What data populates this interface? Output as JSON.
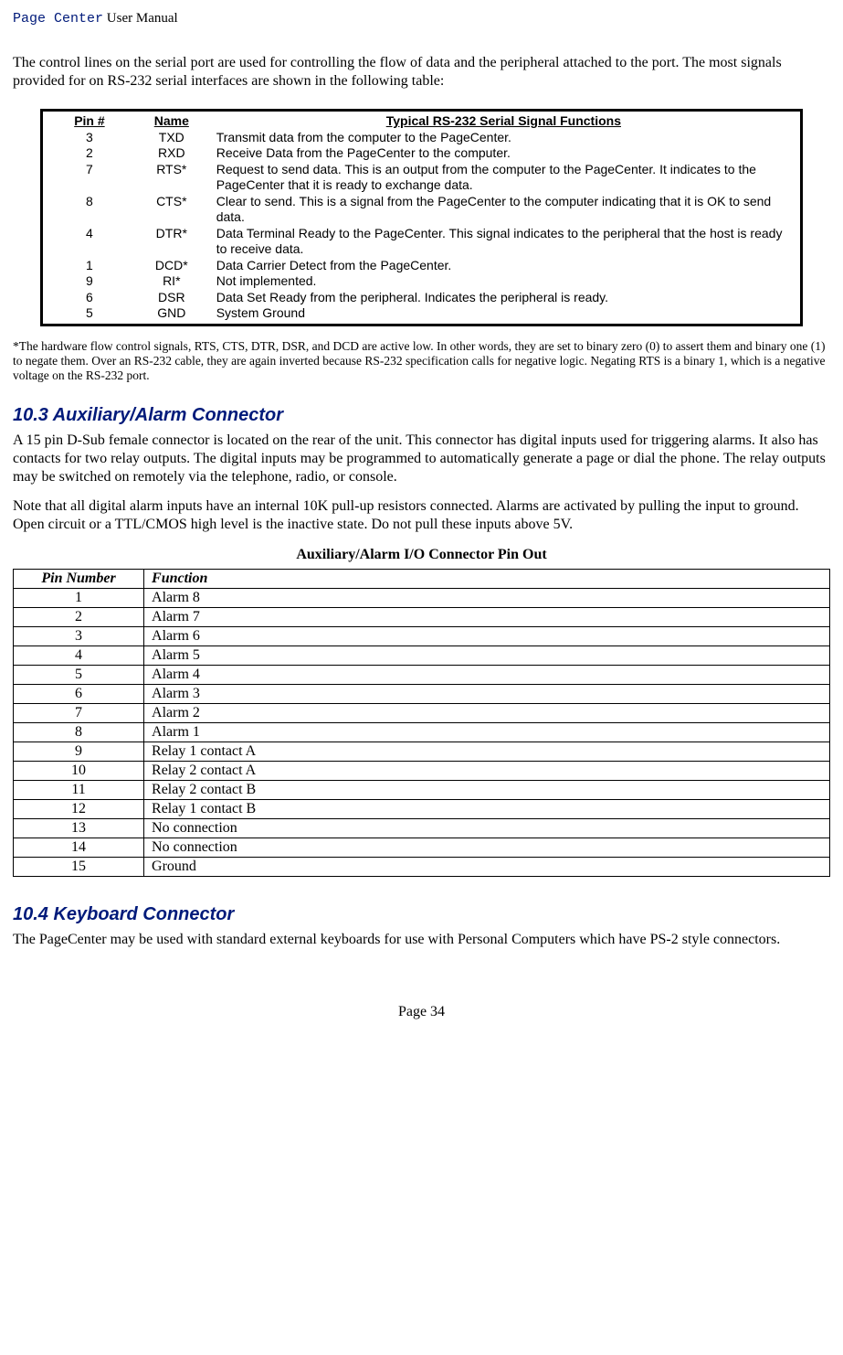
{
  "header": {
    "mono": "Page Center",
    "rest": " User Manual"
  },
  "intro": "The control lines on the serial port are used for controlling the flow of data and the peripheral attached to the port.  The most signals provided for on RS-232 serial interfaces are shown in the following table:",
  "rs232": {
    "headers": {
      "pin": "Pin #",
      "name": "Name",
      "func": "Typical RS-232 Serial Signal Functions"
    },
    "rows": [
      {
        "pin": "3",
        "name": "TXD",
        "func": "Transmit data from the computer to the PageCenter."
      },
      {
        "pin": "2",
        "name": "RXD",
        "func": "Receive Data from the PageCenter to the computer."
      },
      {
        "pin": "7",
        "name": "RTS*",
        "func": "Request to send data. This is an output from the computer to the PageCenter. It indicates to the PageCenter that it is ready to exchange data."
      },
      {
        "pin": "8",
        "name": "CTS*",
        "func": "Clear to send. This is a signal from the PageCenter to the computer indicating that it is OK to send data."
      },
      {
        "pin": "4",
        "name": "DTR*",
        "func": "Data Terminal Ready to the PageCenter. This signal indicates to the peripheral that the host is ready to receive data."
      },
      {
        "pin": "1",
        "name": "DCD*",
        "func": "Data Carrier Detect from the PageCenter."
      },
      {
        "pin": "9",
        "name": "RI*",
        "func": "Not implemented."
      },
      {
        "pin": "6",
        "name": "DSR",
        "func": "Data Set Ready from the peripheral.  Indicates the peripheral is ready."
      },
      {
        "pin": "5",
        "name": "GND",
        "func": "System Ground"
      }
    ]
  },
  "footnote": "*The hardware flow control signals, RTS, CTS, DTR, DSR, and DCD are active low.  In other words, they are set to binary zero (0) to assert them and binary one (1) to negate them.  Over an RS-232 cable, they are again inverted because RS-232 specification calls for negative logic. Negating RTS is a binary 1, which is a negative voltage on the RS-232 port.",
  "section103": {
    "title": "10.3  Auxiliary/Alarm Connector",
    "p1": "A 15 pin D-Sub female connector is located on the rear of the unit.  This connector has digital inputs used for triggering alarms. It also has contacts for two relay outputs.  The digital inputs may be programmed to automatically generate a page or dial the phone. The relay outputs may be switched on remotely via the telephone, radio, or console.",
    "p2": "Note that all digital alarm inputs have an internal 10K pull-up resistors connected.  Alarms are activated by pulling the input to ground. Open circuit or a TTL/CMOS high level is the inactive state. Do not pull these inputs above 5V.",
    "tableTitle": "Auxiliary/Alarm I/O Connector Pin Out",
    "headers": {
      "pin": "Pin Number",
      "func": "Function"
    },
    "rows": [
      {
        "pin": "1",
        "func": "Alarm 8"
      },
      {
        "pin": "2",
        "func": "Alarm 7"
      },
      {
        "pin": "3",
        "func": "Alarm 6"
      },
      {
        "pin": "4",
        "func": "Alarm 5"
      },
      {
        "pin": "5",
        "func": "Alarm 4"
      },
      {
        "pin": "6",
        "func": "Alarm 3"
      },
      {
        "pin": "7",
        "func": "Alarm 2"
      },
      {
        "pin": "8",
        "func": "Alarm 1"
      },
      {
        "pin": "9",
        "func": "Relay 1 contact A"
      },
      {
        "pin": "10",
        "func": "Relay 2 contact A"
      },
      {
        "pin": "11",
        "func": "Relay 2 contact B"
      },
      {
        "pin": "12",
        "func": "Relay 1 contact B"
      },
      {
        "pin": "13",
        "func": "No connection"
      },
      {
        "pin": "14",
        "func": "No connection"
      },
      {
        "pin": "15",
        "func": "Ground"
      }
    ]
  },
  "section104": {
    "title": "10.4  Keyboard Connector",
    "p1": "The PageCenter may be used with standard external keyboards for use with Personal Computers which have PS-2 style connectors."
  },
  "pageNum": "Page 34"
}
